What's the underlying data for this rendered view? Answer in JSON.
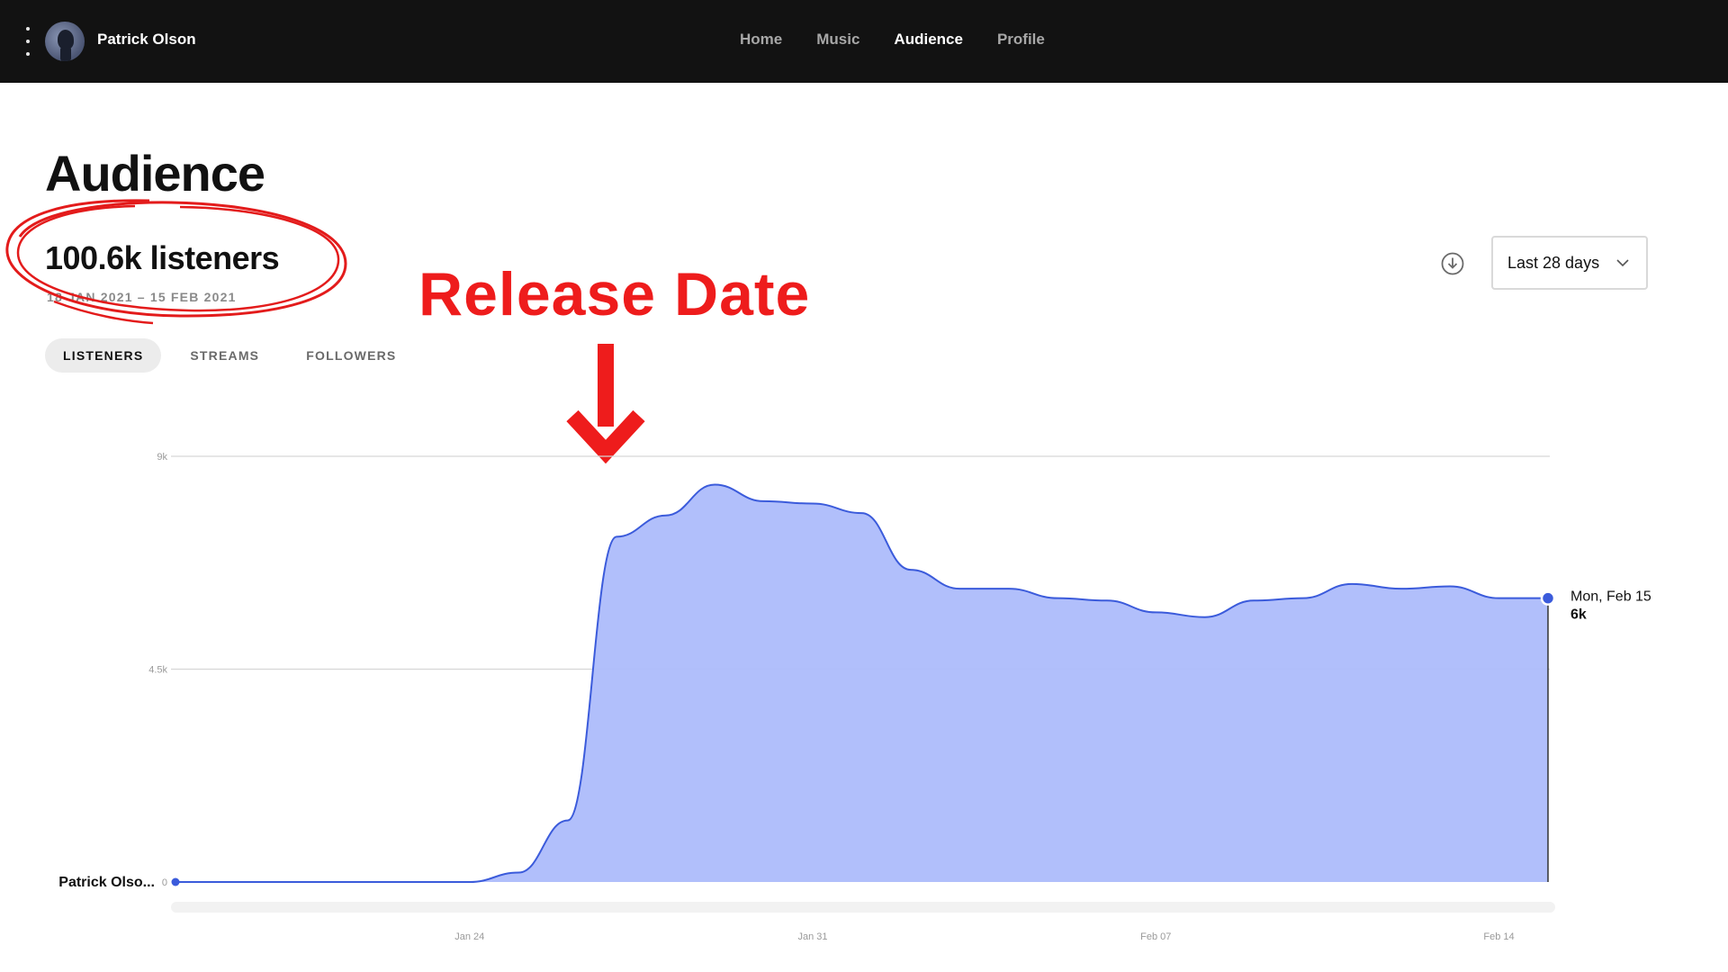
{
  "nav": {
    "artist_name": "Patrick Olson",
    "links": [
      "Home",
      "Music",
      "Audience",
      "Profile"
    ],
    "active": "Audience"
  },
  "page": {
    "title": "Audience",
    "total": "100.6k listeners",
    "date_range": "18 JAN 2021 – 15 FEB 2021"
  },
  "annotation": {
    "label": "Release Date",
    "color": "#ee1c1c"
  },
  "controls": {
    "range_label": "Last 28 days"
  },
  "tabs": [
    "LISTENERS",
    "STREAMS",
    "FOLLOWERS"
  ],
  "chart_data": {
    "type": "area",
    "series": [
      {
        "name": "Patrick Olso...",
        "x": [
          "Jan 18",
          "Jan 19",
          "Jan 20",
          "Jan 21",
          "Jan 22",
          "Jan 23",
          "Jan 24",
          "Jan 25",
          "Jan 26",
          "Jan 27",
          "Jan 28",
          "Jan 29",
          "Jan 30",
          "Jan 31",
          "Feb 01",
          "Feb 02",
          "Feb 03",
          "Feb 04",
          "Feb 05",
          "Feb 06",
          "Feb 07",
          "Feb 08",
          "Feb 09",
          "Feb 10",
          "Feb 11",
          "Feb 12",
          "Feb 13",
          "Feb 14",
          "Feb 15"
        ],
        "values": [
          0,
          0,
          0,
          0,
          0,
          0,
          0,
          200,
          1300,
          7300,
          7750,
          8400,
          8050,
          8000,
          7800,
          6600,
          6200,
          6200,
          6000,
          5950,
          5700,
          5600,
          5950,
          6000,
          6300,
          6200,
          6250,
          6000,
          6000
        ],
        "color": "#adbcfb",
        "line_color": "#3b5bdb"
      }
    ],
    "yticks": [
      "0",
      "4.5k",
      "9k"
    ],
    "ylim": [
      0,
      9000
    ],
    "xtick_labels": [
      "Jan 24",
      "Jan 31",
      "Feb 07",
      "Feb 14"
    ],
    "tooltip": {
      "date": "Mon, Feb 15",
      "value": "6k"
    },
    "grid": true
  }
}
